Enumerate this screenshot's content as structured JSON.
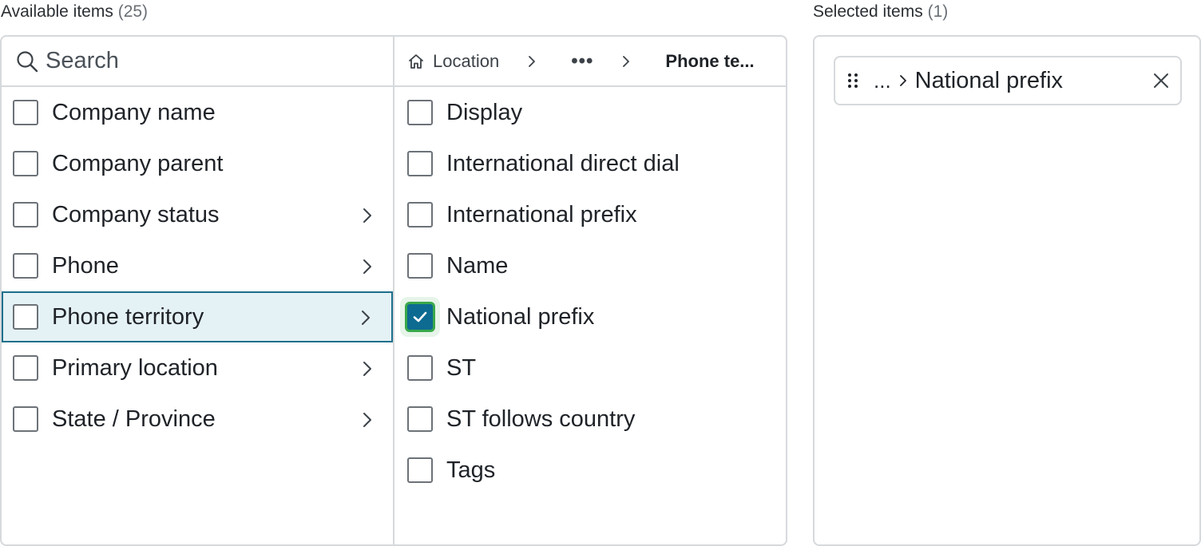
{
  "available": {
    "title": "Available items",
    "count": "(25)",
    "search": {
      "placeholder": "Search",
      "value": ""
    },
    "breadcrumb": {
      "home": "Location",
      "ellipsis": "•••",
      "current": "Phone te..."
    },
    "left_items": [
      {
        "label": "Company name",
        "has_children": false,
        "highlighted": false
      },
      {
        "label": "Company parent",
        "has_children": false,
        "highlighted": false
      },
      {
        "label": "Company status",
        "has_children": true,
        "highlighted": false
      },
      {
        "label": "Phone",
        "has_children": true,
        "highlighted": false
      },
      {
        "label": "Phone territory",
        "has_children": true,
        "highlighted": true
      },
      {
        "label": "Primary location",
        "has_children": true,
        "highlighted": false
      },
      {
        "label": "State / Province",
        "has_children": true,
        "highlighted": false
      }
    ],
    "right_items": [
      {
        "label": "Display",
        "checked": false
      },
      {
        "label": "International direct dial",
        "checked": false
      },
      {
        "label": "International prefix",
        "checked": false
      },
      {
        "label": "Name",
        "checked": false
      },
      {
        "label": "National prefix",
        "checked": true
      },
      {
        "label": "ST",
        "checked": false
      },
      {
        "label": "ST follows country",
        "checked": false
      },
      {
        "label": "Tags",
        "checked": false
      }
    ]
  },
  "selected": {
    "title": "Selected items",
    "count": "(1)",
    "chips": [
      {
        "prefix": "...",
        "label": "National prefix"
      }
    ]
  },
  "colors": {
    "accent": "#0d6b91",
    "focus_ring": "#39a84a",
    "highlight_bg": "#e4f1f5",
    "highlight_border": "#1c6f8c",
    "border": "#d6d9dc"
  },
  "icons": {
    "search": "search-icon",
    "home": "home-icon",
    "chevron": "chevron-right-icon",
    "grip": "drag-handle-icon",
    "close": "close-icon",
    "check": "checkmark-icon"
  }
}
